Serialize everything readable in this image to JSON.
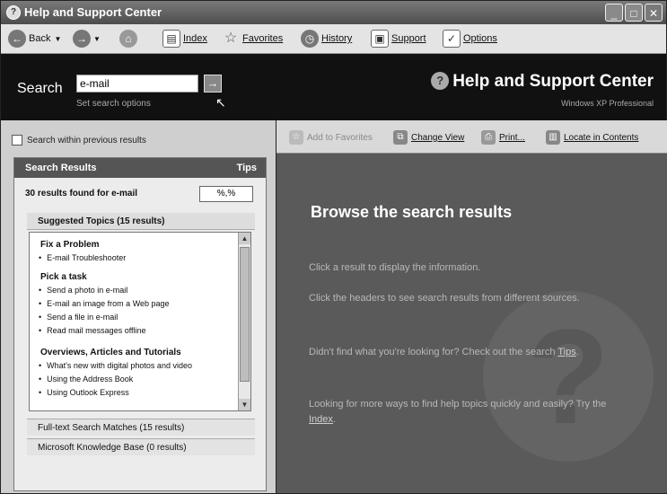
{
  "window": {
    "title": "Help and Support Center",
    "icon": "help-icon"
  },
  "toolbar": {
    "back": "Back",
    "forward_icon": "forward-arrow-icon",
    "home_icon": "home-icon",
    "index": "Index",
    "favorites": "Favorites",
    "history": "History",
    "support": "Support",
    "options": "Options"
  },
  "search": {
    "label": "Search",
    "value": "e-mail",
    "set_options": "Set search options",
    "brand": "Help and Support Center",
    "brand_sub": "Windows XP Professional"
  },
  "left": {
    "within": "Search within previous results",
    "panel_title": "Search Results",
    "tips": "Tips",
    "count": "30 results found for e-mail",
    "count_box": "%,%",
    "suggested": "Suggested Topics (15 results)",
    "groups": [
      {
        "title": "Fix a Problem",
        "items": [
          "E-mail Troubleshooter"
        ]
      },
      {
        "title": "Pick a task",
        "items": [
          "Send a photo in e-mail",
          "E-mail an image from a Web page",
          "Send a file in e-mail",
          "Read mail messages offline"
        ]
      },
      {
        "title": "Overviews, Articles and Tutorials",
        "items": [
          "What's new with digital photos and video",
          "Using the Address Book",
          "Using Outlook Express"
        ]
      }
    ],
    "fulltext": "Full-text Search Matches (15 results)",
    "kb": "Microsoft Knowledge Base (0 results)"
  },
  "right": {
    "add_fav": "Add to Favorites",
    "change_view": "Change View",
    "print": "Print...",
    "locate": "Locate in Contents",
    "title": "Browse the search results",
    "p1": "Click a result to display the information.",
    "p2": "Click the headers to see search results from different sources.",
    "p3a": "Didn't find what you're looking for? Check out the search ",
    "p3link": "Tips",
    "p3b": ".",
    "p4a": "Looking for more ways to find help topics quickly and easily? Try the ",
    "p4link": "Index",
    "p4b": "."
  }
}
